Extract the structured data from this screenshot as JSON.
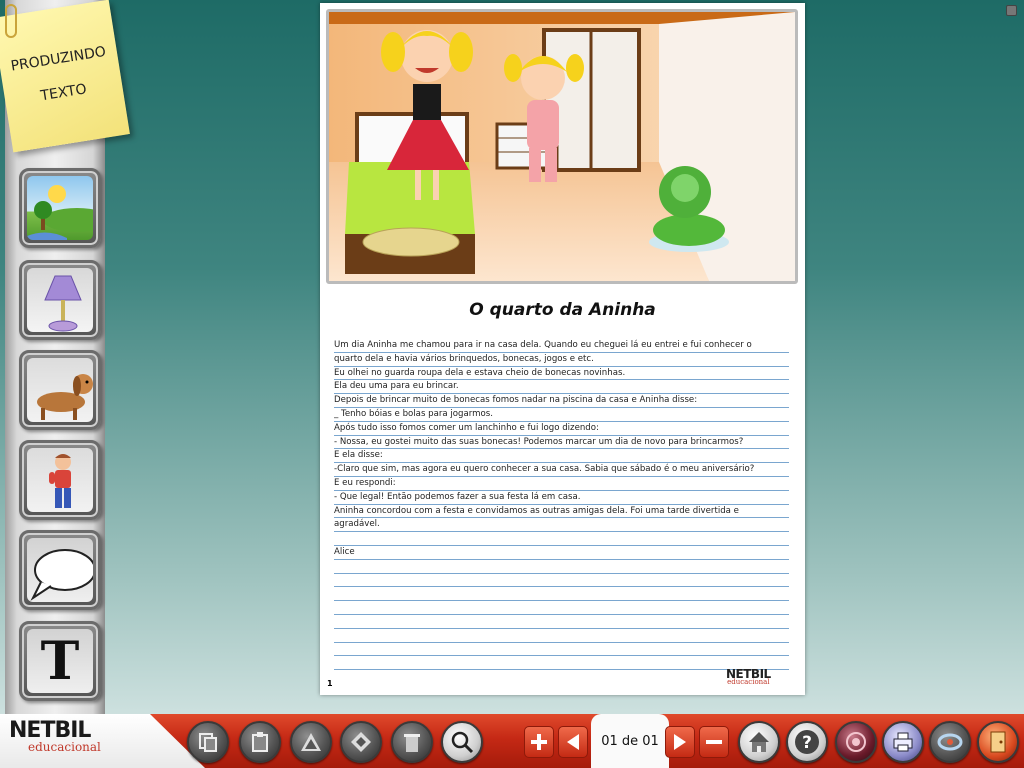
{
  "sidebar": {
    "note_line1": "PRODUZINDO",
    "note_line2": "TEXTO",
    "tools": [
      {
        "name": "landscape-tool",
        "icon": "landscape-icon"
      },
      {
        "name": "objects-tool",
        "icon": "lamp-icon"
      },
      {
        "name": "animals-tool",
        "icon": "dog-icon"
      },
      {
        "name": "characters-tool",
        "icon": "boy-icon"
      },
      {
        "name": "speech-balloon-tool",
        "icon": "speech-balloon-icon"
      },
      {
        "name": "text-tool",
        "icon": "text-icon",
        "glyph": "T"
      }
    ]
  },
  "document": {
    "title": "O quarto da Aninha",
    "lines": [
      "     Um dia Aninha me chamou para ir na casa dela. Quando eu cheguei lá eu entrei e fui conhecer o",
      "quarto dela e havia vários brinquedos, bonecas, jogos e etc.",
      "     Eu olhei no guarda roupa dela e  estava cheio de bonecas novinhas.",
      "     Ela deu uma para eu brincar.",
      "     Depois de brincar muito de bonecas fomos nadar na piscina da casa e Aninha disse:",
      "     _ Tenho bóias e bolas para jogarmos.",
      "     Após tudo isso fomos comer um lanchinho e fui logo dizendo:",
      "     - Nossa, eu gostei muito das suas bonecas! Podemos marcar um dia de novo para brincarmos?",
      "     E ela disse:",
      "     -Claro que sim, mas agora eu quero conhecer a sua casa. Sabia que sábado é o meu aniversário?",
      "     E eu respondi:",
      "     - Que legal! Então podemos fazer a sua festa lá em casa.",
      "     Aninha concordou com a festa e convidamos as outras amigas dela. Foi uma tarde divertida e",
      "agradável.",
      "",
      "     Alice",
      "",
      "",
      "",
      "",
      "",
      "",
      "",
      ""
    ],
    "page_number": "1",
    "logo_main": "NETBIL",
    "logo_sub": "educacional"
  },
  "toolbar": {
    "logo_main": "NETBIL",
    "logo_sub": "educacional",
    "page_counter": "01 de 01",
    "buttons": [
      "copy-icon",
      "paste-icon",
      "bring-front-icon",
      "send-back-icon",
      "trash-icon",
      "zoom-icon",
      "add-page-icon",
      "prev-page-icon",
      "next-page-icon",
      "remove-page-icon",
      "home-icon",
      "help-icon",
      "audio-icon",
      "print-icon",
      "save-icon",
      "exit-icon"
    ]
  },
  "colors": {
    "toolbar_red": "#c52915",
    "background_teal": "#1e6b66",
    "rule_blue": "#7aa6cf"
  }
}
